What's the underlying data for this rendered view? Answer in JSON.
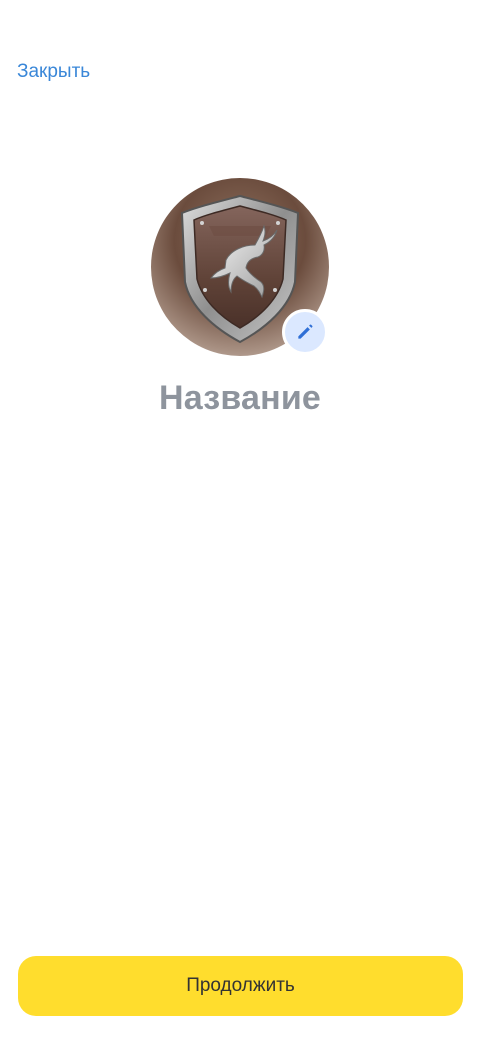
{
  "header": {
    "close_label": "Закрыть"
  },
  "avatar": {
    "image_description": "shield-with-deer-emblem",
    "edit_icon": "pencil-icon"
  },
  "title": "Название",
  "actions": {
    "continue_label": "Продолжить"
  },
  "colors": {
    "link": "#3a87d8",
    "accent_button": "#ffdd2d",
    "title_text": "#8e949d",
    "edit_badge_bg": "#dbe8ff",
    "edit_icon": "#2f6fd6"
  }
}
